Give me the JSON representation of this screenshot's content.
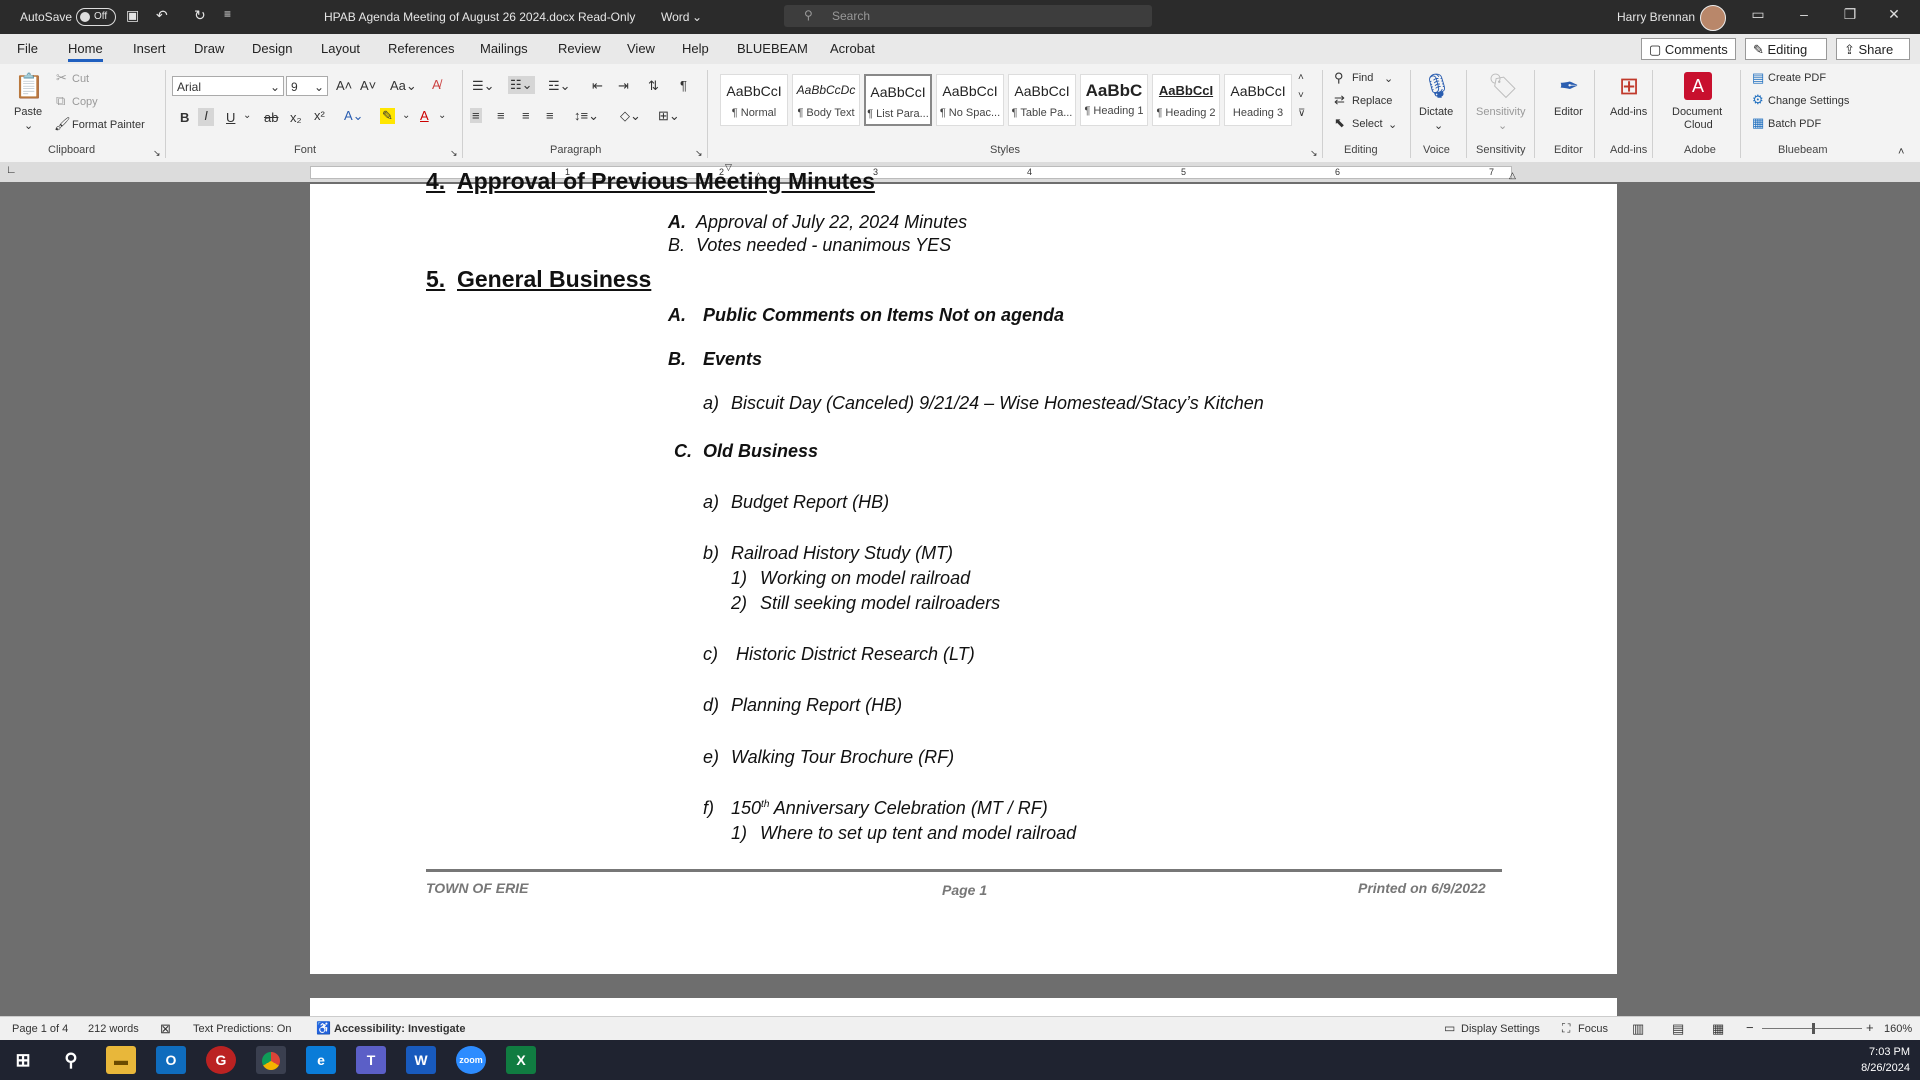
{
  "titlebar": {
    "autosave_label": "AutoSave",
    "autosave_state": "Off",
    "doc_title": "HPAB Agenda Meeting of August 26 2024.docx",
    "mode": "Read-Only",
    "app": "Word",
    "search_placeholder": "Search",
    "user": "Harry Brennan"
  },
  "menu": {
    "tabs": [
      "File",
      "Home",
      "Insert",
      "Draw",
      "Design",
      "Layout",
      "References",
      "Mailings",
      "Review",
      "View",
      "Help",
      "BLUEBEAM",
      "Acrobat"
    ],
    "comments": "Comments",
    "editing": "Editing",
    "share": "Share"
  },
  "ribbon": {
    "clipboard": {
      "paste": "Paste",
      "cut": "Cut",
      "copy": "Copy",
      "format_painter": "Format Painter",
      "label": "Clipboard"
    },
    "font": {
      "name": "Arial",
      "size": "9",
      "label": "Font"
    },
    "paragraph": {
      "label": "Paragraph"
    },
    "styles": {
      "label": "Styles",
      "items": [
        {
          "preview": "AaBbCcI",
          "name": "¶ Normal"
        },
        {
          "preview": "AaBbCcDc",
          "name": "¶ Body Text"
        },
        {
          "preview": "AaBbCcI",
          "name": "¶ List Para..."
        },
        {
          "preview": "AaBbCcI",
          "name": "¶ No Spac..."
        },
        {
          "preview": "AaBbCcI",
          "name": "¶ Table Pa..."
        },
        {
          "preview": "AaBbC",
          "name": "¶ Heading 1"
        },
        {
          "preview": "AaBbCcI",
          "name": "¶ Heading 2"
        },
        {
          "preview": "AaBbCcI",
          "name": "Heading 3"
        }
      ]
    },
    "editing": {
      "find": "Find",
      "replace": "Replace",
      "select": "Select",
      "label": "Editing"
    },
    "voice": {
      "dictate": "Dictate",
      "label": "Voice"
    },
    "sensitivity": {
      "btn": "Sensitivity",
      "label": "Sensitivity"
    },
    "editor": {
      "btn": "Editor",
      "label": "Editor"
    },
    "addins": {
      "btn": "Add-ins",
      "label": "Add-ins"
    },
    "adobe": {
      "btn1": "Document",
      "btn2": "Cloud",
      "label": "Adobe"
    },
    "bluebeam": {
      "create": "Create PDF",
      "change": "Change Settings",
      "batch": "Batch PDF",
      "label": "Bluebeam"
    }
  },
  "ruler": {
    "marks": [
      "1",
      "2",
      "3",
      "4",
      "5",
      "6",
      "7"
    ]
  },
  "document": {
    "item4_num": "4.",
    "item4_title": "Approval of Previous Meeting Minutes",
    "item4_a_marker": "A.",
    "item4_a": "Approval of July 22, 2024 Minutes",
    "item4_b_marker": "B.",
    "item4_b": "Votes needed - unanimous YES",
    "item5_num": "5.",
    "item5_title": "General Business",
    "a_marker": "A.",
    "a_title": "Public Comments on Items Not on agenda",
    "b_marker": "B.",
    "b_title": "Events",
    "b_a_marker": "a)",
    "b_a": "Biscuit Day (Canceled) 9/21/24 – Wise Homestead/Stacy’s Kitchen",
    "c_marker": "C.",
    "c_title": "Old Business",
    "c_a_marker": "a)",
    "c_a": "Budget Report (HB)",
    "c_b_marker": "b)",
    "c_b": "Railroad History Study (MT)",
    "c_b_1_marker": "1)",
    "c_b_1": "Working on model railroad",
    "c_b_2_marker": "2)",
    "c_b_2": "Still seeking model railroaders",
    "c_c_marker": "c)",
    "c_c": "Historic District Research (LT)",
    "c_d_marker": "d)",
    "c_d": "Planning Report (HB)",
    "c_e_marker": "e)",
    "c_e": "Walking Tour Brochure (RF)",
    "c_f_marker": "f)",
    "c_f_pre": "150",
    "c_f_sup": "th",
    "c_f_post": " Anniversary Celebration (MT / RF)",
    "c_f_1_marker": "1)",
    "c_f_1": "Where to set up tent and model railroad",
    "footer_left": "TOWN OF ERIE",
    "footer_center": "Page 1",
    "footer_right": "Printed on 6/9/2022"
  },
  "status": {
    "page": "Page 1 of 4",
    "words": "212 words",
    "predictions": "Text Predictions: On",
    "accessibility": "Accessibility: Investigate",
    "display": "Display Settings",
    "focus": "Focus",
    "zoom": "160%"
  },
  "taskbar": {
    "time": "7:03 PM",
    "date": "8/26/2024"
  }
}
